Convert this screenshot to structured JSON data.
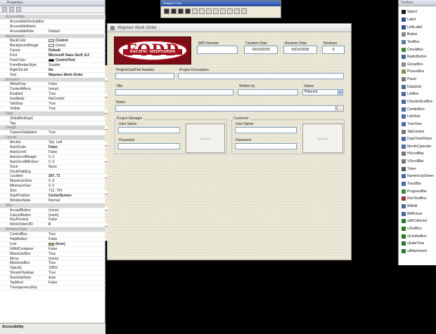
{
  "properties": {
    "title": "Properties",
    "rows": [
      {
        "name": "Accessibility",
        "value": "",
        "type": "cat"
      },
      {
        "name": "AccessibleDescription",
        "value": ""
      },
      {
        "name": "AccessibleName",
        "value": ""
      },
      {
        "name": "AccessibleRole",
        "value": "Default"
      },
      {
        "name": "Appearance",
        "value": "",
        "type": "cat"
      },
      {
        "name": "BackColor",
        "value": "Control",
        "swatch": "#ece9d8",
        "bold": true
      },
      {
        "name": "BackgroundImage",
        "value": "(none)",
        "swatch": "#ffffff"
      },
      {
        "name": "Cursor",
        "value": "Default",
        "bold": true
      },
      {
        "name": "Font",
        "value": "Microsoft Sans Serif, 8.2",
        "bold": true
      },
      {
        "name": "ForeColor",
        "value": "ControlText",
        "swatch": "#000000",
        "bold": true
      },
      {
        "name": "FormBorderStyle",
        "value": "Sizable"
      },
      {
        "name": "RightToLeft",
        "value": "No",
        "bold": true
      },
      {
        "name": "Text",
        "value": "Waymes Work Order",
        "bold": true
      },
      {
        "name": "Behavior",
        "value": "",
        "type": "cat"
      },
      {
        "name": "AllowDrop",
        "value": "False"
      },
      {
        "name": "ContextMenu",
        "value": "(none)"
      },
      {
        "name": "Enabled",
        "value": "True"
      },
      {
        "name": "ImeMode",
        "value": "NoControl"
      },
      {
        "name": "TabStop",
        "value": "True"
      },
      {
        "name": "Visible",
        "value": "True"
      },
      {
        "name": "Data",
        "value": "",
        "type": "cat"
      },
      {
        "name": "(DataBindings)",
        "value": ""
      },
      {
        "name": "Tag",
        "value": ""
      },
      {
        "name": "Design",
        "value": "",
        "type": "cat"
      },
      {
        "name": "CausesValidation",
        "value": "True"
      },
      {
        "name": "Layout",
        "value": "",
        "type": "cat"
      },
      {
        "name": "Anchor",
        "value": "Top, Left"
      },
      {
        "name": "AutoScale",
        "value": "False",
        "bold": true
      },
      {
        "name": "AutoScroll",
        "value": "False"
      },
      {
        "name": "AutoScrollMargin",
        "value": "0, 0"
      },
      {
        "name": "AutoScrollMinSize",
        "value": "0, 0"
      },
      {
        "name": "Dock",
        "value": "None"
      },
      {
        "name": "DockPadding",
        "value": ""
      },
      {
        "name": "Location",
        "value": "267, 71",
        "bold": true
      },
      {
        "name": "MaximumSize",
        "value": "0, 0"
      },
      {
        "name": "MinimumSize",
        "value": "0, 0"
      },
      {
        "name": "Size",
        "value": "712, 724"
      },
      {
        "name": "StartPosition",
        "value": "CenterScreen",
        "bold": true
      },
      {
        "name": "WindowState",
        "value": "Normal"
      },
      {
        "name": "Misc",
        "value": "",
        "type": "cat"
      },
      {
        "name": "AcceptButton",
        "value": "(none)"
      },
      {
        "name": "CancelButton",
        "value": "(none)"
      },
      {
        "name": "KeyPreview",
        "value": "False"
      },
      {
        "name": "WorkOrderUID",
        "value": "0",
        "bold": true
      },
      {
        "name": "Window Style",
        "value": "",
        "type": "cat"
      },
      {
        "name": "ControlBox",
        "value": "True"
      },
      {
        "name": "HelpButton",
        "value": "False"
      },
      {
        "name": "Icon",
        "value": "(Icon)",
        "swatch": "#c8b070",
        "bold": true
      },
      {
        "name": "IsMdiContainer",
        "value": "False"
      },
      {
        "name": "MaximizeBox",
        "value": "True"
      },
      {
        "name": "Menu",
        "value": "(none)"
      },
      {
        "name": "MinimizeBox",
        "value": "True"
      },
      {
        "name": "Opacity",
        "value": "100%"
      },
      {
        "name": "ShowInTaskbar",
        "value": "True"
      },
      {
        "name": "SizeGripStyle",
        "value": "Auto"
      },
      {
        "name": "TopMost",
        "value": "False"
      },
      {
        "name": "TransparencyKey",
        "value": ""
      }
    ],
    "description": "Accessibility"
  },
  "designer_toolbar": {
    "title": "Designer Form"
  },
  "toolbox": {
    "title": "Toolbox",
    "items": [
      {
        "label": "Select",
        "color": "#222"
      },
      {
        "label": "Label",
        "color": "#2a4fa0"
      },
      {
        "label": "LinkLabel",
        "color": "#2a4fa0"
      },
      {
        "label": "Button",
        "color": "#888"
      },
      {
        "label": "TextBox",
        "color": "#5a7ab0"
      },
      {
        "label": "CheckBox",
        "color": "#3a8a3a"
      },
      {
        "label": "RadioButton",
        "color": "#3a6a9a"
      },
      {
        "label": "GroupBox",
        "color": "#888"
      },
      {
        "label": "PictureBox",
        "color": "#7a9a50"
      },
      {
        "label": "Panel",
        "color": "#777"
      },
      {
        "label": "DataGrid",
        "color": "#4a6aa0"
      },
      {
        "label": "ListBox",
        "color": "#4a6aa0"
      },
      {
        "label": "CheckedListBox",
        "color": "#4a6aa0"
      },
      {
        "label": "ComboBox",
        "color": "#4a6aa0"
      },
      {
        "label": "ListView",
        "color": "#4a6aa0"
      },
      {
        "label": "TreeView",
        "color": "#4a6aa0"
      },
      {
        "label": "TabControl",
        "color": "#777"
      },
      {
        "label": "DateTimePicker",
        "color": "#4a6aa0"
      },
      {
        "label": "MonthCalendar",
        "color": "#4a6aa0"
      },
      {
        "label": "HScrollBar",
        "color": "#777"
      },
      {
        "label": "VScrollBar",
        "color": "#777"
      },
      {
        "label": "Timer",
        "color": "#556"
      },
      {
        "label": "NumericUpDown",
        "color": "#4a6aa0"
      },
      {
        "label": "TrackBar",
        "color": "#4a6aa0"
      },
      {
        "label": "ProgressBar",
        "color": "#3a8a3a"
      },
      {
        "label": "RichTextBox",
        "color": "#a03030"
      },
      {
        "label": "BitEdit",
        "color": "#4a6aa0"
      },
      {
        "label": "BitPicture",
        "color": "#4a6aa0"
      },
      {
        "label": "ubKCollector",
        "color": "#2a7a2a"
      },
      {
        "label": "uTextBox",
        "color": "#2a7a2a"
      },
      {
        "label": "uComboBox",
        "color": "#2a7a2a"
      },
      {
        "label": "uDateTime",
        "color": "#2a7a2a"
      },
      {
        "label": "uAttachment",
        "color": "#2a7a2a"
      }
    ]
  },
  "form": {
    "title": "Waymes Work Order",
    "logo_text": "FODD",
    "logo_band": "PACIFIC SHIPYARDS",
    "wo_number_label": "W/O Number",
    "creation_date_label": "Creation Date",
    "creation_date_value": "09/16/2005",
    "revision_date_label": "Revision Date",
    "revision_date_value": "09/16/2005",
    "revision_label": "Revision",
    "revision_value": "0",
    "project_job_label": "Project/Job/Part Number",
    "project_desc_label": "Project Description",
    "title_label": "Title",
    "written_by_label": "Written by",
    "status_label": "Status",
    "status_value": "Planned",
    "notes_label": "Notes",
    "notes_button": "...",
    "pm_group_label": "Project Manager",
    "pm_user_label": "User Name",
    "pm_password_label": "Password",
    "pm_approve_button": "Approve",
    "customer_group_label": "Customer",
    "cust_user_label": "User Name",
    "cust_password_label": "Password",
    "cust_approve_button": "Approve"
  }
}
